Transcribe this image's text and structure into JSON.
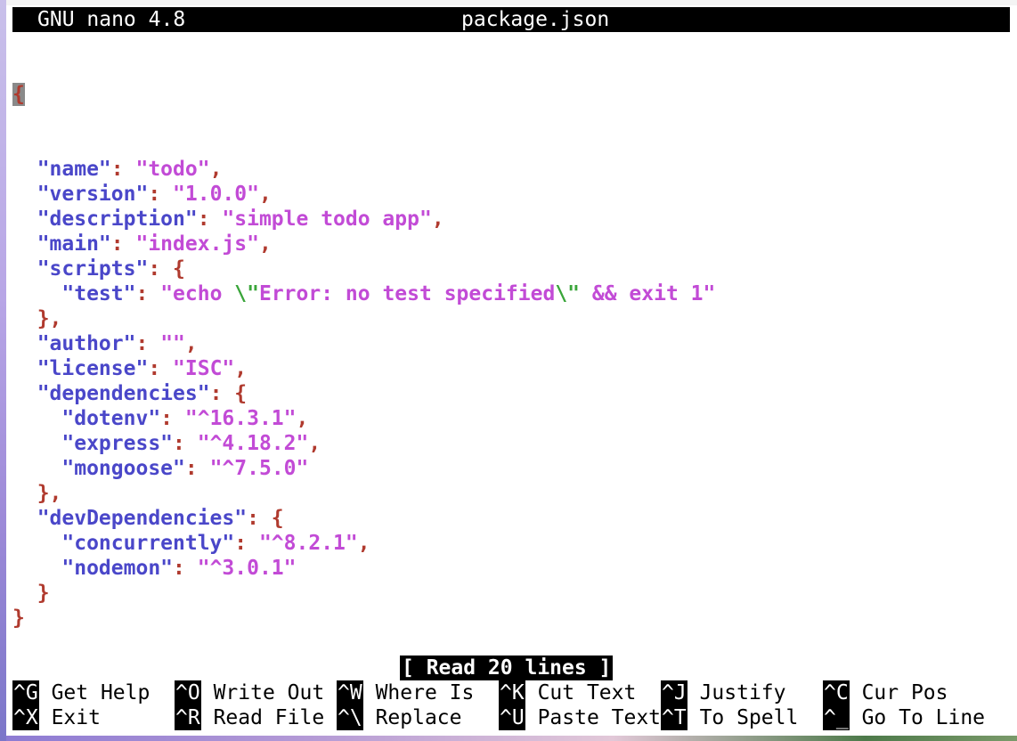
{
  "titlebar": {
    "program": "GNU nano 4.8",
    "filename": "package.json"
  },
  "editor": {
    "cursor_char": "{",
    "lines": [
      [
        {
          "t": "k",
          "v": "  \"name\""
        },
        {
          "t": "p",
          "v": ": "
        },
        {
          "t": "s",
          "v": "\"todo\""
        },
        {
          "t": "p",
          "v": ","
        }
      ],
      [
        {
          "t": "k",
          "v": "  \"version\""
        },
        {
          "t": "p",
          "v": ": "
        },
        {
          "t": "s",
          "v": "\"1.0.0\""
        },
        {
          "t": "p",
          "v": ","
        }
      ],
      [
        {
          "t": "k",
          "v": "  \"description\""
        },
        {
          "t": "p",
          "v": ": "
        },
        {
          "t": "s",
          "v": "\"simple todo app\""
        },
        {
          "t": "p",
          "v": ","
        }
      ],
      [
        {
          "t": "k",
          "v": "  \"main\""
        },
        {
          "t": "p",
          "v": ": "
        },
        {
          "t": "s",
          "v": "\"index.js\""
        },
        {
          "t": "p",
          "v": ","
        }
      ],
      [
        {
          "t": "k",
          "v": "  \"scripts\""
        },
        {
          "t": "p",
          "v": ": {"
        }
      ],
      [
        {
          "t": "k",
          "v": "    \"test\""
        },
        {
          "t": "p",
          "v": ": "
        },
        {
          "t": "s",
          "v": "\"echo "
        },
        {
          "t": "e",
          "v": "\\\""
        },
        {
          "t": "s",
          "v": "Error: no test specified"
        },
        {
          "t": "e",
          "v": "\\\""
        },
        {
          "t": "s",
          "v": " && exit 1\""
        }
      ],
      [
        {
          "t": "p",
          "v": "  },"
        }
      ],
      [
        {
          "t": "k",
          "v": "  \"author\""
        },
        {
          "t": "p",
          "v": ": "
        },
        {
          "t": "s",
          "v": "\"\""
        },
        {
          "t": "p",
          "v": ","
        }
      ],
      [
        {
          "t": "k",
          "v": "  \"license\""
        },
        {
          "t": "p",
          "v": ": "
        },
        {
          "t": "s",
          "v": "\"ISC\""
        },
        {
          "t": "p",
          "v": ","
        }
      ],
      [
        {
          "t": "k",
          "v": "  \"dependencies\""
        },
        {
          "t": "p",
          "v": ": {"
        }
      ],
      [
        {
          "t": "k",
          "v": "    \"dotenv\""
        },
        {
          "t": "p",
          "v": ": "
        },
        {
          "t": "s",
          "v": "\"^16.3.1\""
        },
        {
          "t": "p",
          "v": ","
        }
      ],
      [
        {
          "t": "k",
          "v": "    \"express\""
        },
        {
          "t": "p",
          "v": ": "
        },
        {
          "t": "s",
          "v": "\"^4.18.2\""
        },
        {
          "t": "p",
          "v": ","
        }
      ],
      [
        {
          "t": "k",
          "v": "    \"mongoose\""
        },
        {
          "t": "p",
          "v": ": "
        },
        {
          "t": "s",
          "v": "\"^7.5.0\""
        }
      ],
      [
        {
          "t": "p",
          "v": "  },"
        }
      ],
      [
        {
          "t": "k",
          "v": "  \"devDependencies\""
        },
        {
          "t": "p",
          "v": ": {"
        }
      ],
      [
        {
          "t": "k",
          "v": "    \"concurrently\""
        },
        {
          "t": "p",
          "v": ": "
        },
        {
          "t": "s",
          "v": "\"^8.2.1\""
        },
        {
          "t": "p",
          "v": ","
        }
      ],
      [
        {
          "t": "k",
          "v": "    \"nodemon\""
        },
        {
          "t": "p",
          "v": ": "
        },
        {
          "t": "s",
          "v": "\"^3.0.1\""
        }
      ],
      [
        {
          "t": "p",
          "v": "  }"
        }
      ],
      [
        {
          "t": "p",
          "v": "}"
        }
      ]
    ]
  },
  "status": "[ Read 20 lines ]",
  "shortcuts": [
    {
      "key": "^G",
      "label": "Get Help"
    },
    {
      "key": "^O",
      "label": "Write Out"
    },
    {
      "key": "^W",
      "label": "Where Is"
    },
    {
      "key": "^K",
      "label": "Cut Text"
    },
    {
      "key": "^J",
      "label": "Justify"
    },
    {
      "key": "^C",
      "label": "Cur Pos"
    },
    {
      "key": "^X",
      "label": "Exit"
    },
    {
      "key": "^R",
      "label": "Read File"
    },
    {
      "key": "^\\",
      "label": "Replace"
    },
    {
      "key": "^U",
      "label": "Paste Text"
    },
    {
      "key": "^T",
      "label": "To Spell"
    },
    {
      "key": "^_",
      "label": "Go To Line"
    }
  ],
  "colors": {
    "key_string": "#4a47c9",
    "value_string": "#c24bd6",
    "punctuation": "#b03a2e",
    "escape": "#3aa53a"
  }
}
